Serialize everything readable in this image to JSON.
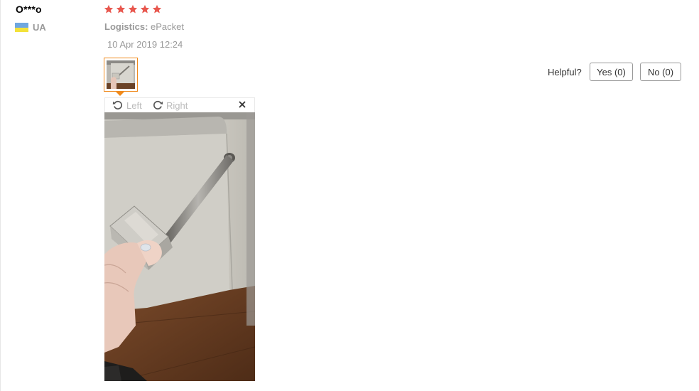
{
  "review": {
    "user_name": "O***o",
    "country_code": "UA",
    "rating": 5,
    "logistics_label": "Logistics:",
    "logistics_value": "ePacket",
    "date": "10 Apr 2019 12:24"
  },
  "viewer": {
    "rotate_left_label": "Left",
    "rotate_right_label": "Right"
  },
  "helpful": {
    "label": "Helpful?",
    "yes_label": "Yes (0)",
    "no_label": "No (0)"
  },
  "colors": {
    "star": "#e8574e",
    "thumb_border": "#f08a1c",
    "flag_blue": "#6fa7e0",
    "flag_yellow": "#f3e23a"
  },
  "icons": [
    "flag-icon",
    "star-icon",
    "rotate-left-icon",
    "rotate-right-icon",
    "close-icon"
  ]
}
